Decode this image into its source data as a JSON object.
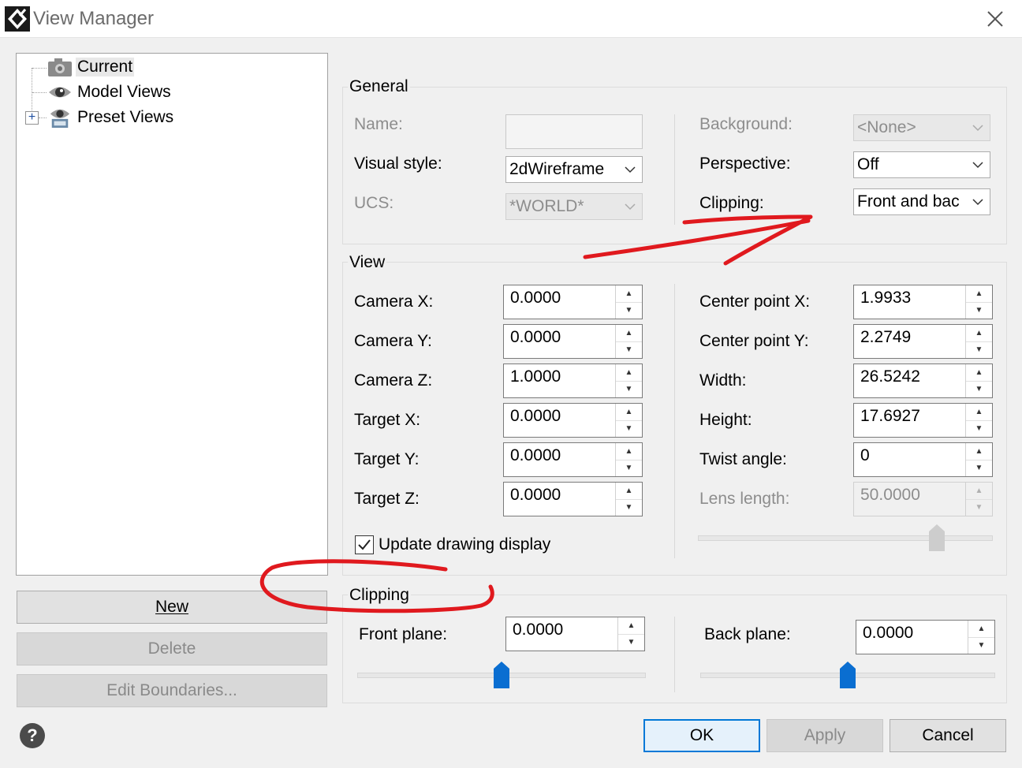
{
  "window": {
    "title": "View Manager"
  },
  "tree": {
    "items": [
      {
        "label": "Current",
        "icon": "camera-icon",
        "selected": true
      },
      {
        "label": "Model Views",
        "icon": "eye-icon"
      },
      {
        "label": "Preset Views",
        "icon": "preset-views-icon",
        "expander": "+"
      }
    ]
  },
  "left_buttons": {
    "new": "New",
    "delete": "Delete",
    "edit_boundaries": "Edit Boundaries..."
  },
  "general": {
    "group_label": "General",
    "name_label": "Name:",
    "name_value": "",
    "visual_style_label": "Visual style:",
    "visual_style_value": "2dWireframe",
    "ucs_label": "UCS:",
    "ucs_value": "*WORLD*",
    "background_label": "Background:",
    "background_value": "<None>",
    "perspective_label": "Perspective:",
    "perspective_value": "Off",
    "clipping_label": "Clipping:",
    "clipping_value": "Front and bac"
  },
  "view": {
    "group_label": "View",
    "camera_x_label": "Camera X:",
    "camera_x": "0.0000",
    "camera_y_label": "Camera Y:",
    "camera_y": "0.0000",
    "camera_z_label": "Camera Z:",
    "camera_z": "1.0000",
    "target_x_label": "Target X:",
    "target_x": "0.0000",
    "target_y_label": "Target Y:",
    "target_y": "0.0000",
    "target_z_label": "Target Z:",
    "target_z": "0.0000",
    "center_x_label": "Center point X:",
    "center_x": "1.9933",
    "center_y_label": "Center point Y:",
    "center_y": "2.2749",
    "width_label": "Width:",
    "width": "26.5242",
    "height_label": "Height:",
    "height": "17.6927",
    "twist_label": "Twist angle:",
    "twist": "0",
    "lens_label": "Lens length:",
    "lens": "50.0000",
    "lens_slider_fraction": 0.81,
    "update_display_label": "Update drawing display",
    "update_display_checked": true
  },
  "clipping": {
    "group_label": "Clipping",
    "front_label": "Front plane:",
    "front_value": "0.0000",
    "back_label": "Back plane:",
    "back_value": "0.0000",
    "front_slider_fraction": 0.5,
    "back_slider_fraction": 0.5
  },
  "bottom_buttons": {
    "ok": "OK",
    "apply": "Apply",
    "cancel": "Cancel"
  },
  "colors": {
    "accent": "#0078d7",
    "slider_thumb": "#0a6ed1",
    "annotation": "#e0191e"
  }
}
